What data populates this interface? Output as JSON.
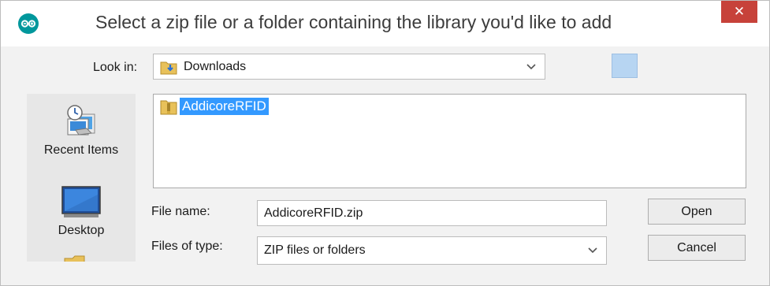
{
  "window": {
    "title": "Select a zip file or a folder containing the library you'd like to add",
    "close_label": "✕"
  },
  "look_in": {
    "label": "Look in:",
    "value": "Downloads"
  },
  "sidebar": {
    "items": [
      {
        "label": "Recent Items",
        "icon": "recent-items-icon"
      },
      {
        "label": "Desktop",
        "icon": "desktop-icon"
      }
    ]
  },
  "file_list": {
    "items": [
      {
        "name": "AddicoreRFID",
        "icon": "zip-folder-icon",
        "selected": true
      }
    ]
  },
  "file_name": {
    "label": "File name:",
    "value": "AddicoreRFID.zip"
  },
  "file_type": {
    "label": "Files of type:",
    "value": "ZIP files or folders"
  },
  "buttons": {
    "open": "Open",
    "cancel": "Cancel"
  },
  "colors": {
    "close": "#c7423a",
    "selection": "#3399ff",
    "arduino": "#00979c"
  }
}
